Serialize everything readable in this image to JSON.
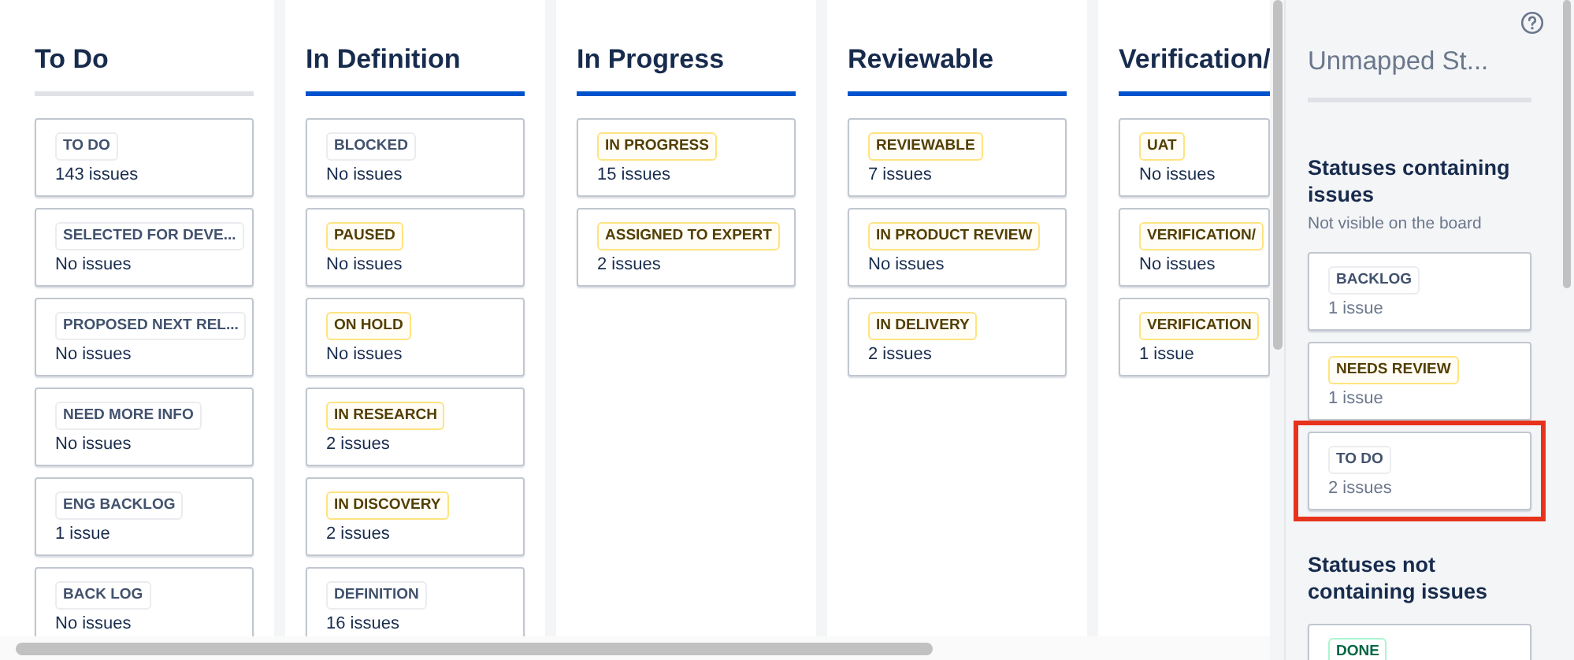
{
  "board": {
    "columns": [
      {
        "name": "To Do",
        "kind": "todo",
        "statuses": [
          {
            "name": "TO DO",
            "kind": "todo",
            "count": "143 issues"
          },
          {
            "name": "SELECTED FOR DEVE...",
            "kind": "todo",
            "count": "No issues"
          },
          {
            "name": "PROPOSED NEXT REL...",
            "kind": "todo",
            "count": "No issues"
          },
          {
            "name": "NEED MORE INFO",
            "kind": "todo",
            "count": "No issues"
          },
          {
            "name": "ENG BACKLOG",
            "kind": "todo",
            "count": "1 issue"
          },
          {
            "name": "BACK LOG",
            "kind": "todo",
            "count": "No issues"
          }
        ]
      },
      {
        "name": "In Definition",
        "kind": "inprogress",
        "statuses": [
          {
            "name": "BLOCKED",
            "kind": "todo",
            "count": "No issues"
          },
          {
            "name": "PAUSED",
            "kind": "inprogress",
            "count": "No issues"
          },
          {
            "name": "ON HOLD",
            "kind": "inprogress",
            "count": "No issues"
          },
          {
            "name": "IN RESEARCH",
            "kind": "inprogress",
            "count": "2 issues"
          },
          {
            "name": "IN DISCOVERY",
            "kind": "inprogress",
            "count": "2 issues"
          },
          {
            "name": "DEFINITION",
            "kind": "todo",
            "count": "16 issues"
          }
        ]
      },
      {
        "name": "In Progress",
        "kind": "inprogress",
        "statuses": [
          {
            "name": "IN PROGRESS",
            "kind": "inprogress",
            "count": "15 issues"
          },
          {
            "name": "ASSIGNED TO EXPERT",
            "kind": "inprogress",
            "count": "2 issues"
          }
        ]
      },
      {
        "name": "Reviewable",
        "kind": "inprogress",
        "statuses": [
          {
            "name": "REVIEWABLE",
            "kind": "inprogress",
            "count": "7 issues"
          },
          {
            "name": "IN PRODUCT REVIEW",
            "kind": "inprogress",
            "count": "No issues"
          },
          {
            "name": "IN DELIVERY",
            "kind": "inprogress",
            "count": "2 issues"
          }
        ]
      },
      {
        "name": "Verification/",
        "kind": "inprogress",
        "statuses": [
          {
            "name": "UAT",
            "kind": "inprogress",
            "count": "No issues"
          },
          {
            "name": "VERIFICATION/",
            "kind": "inprogress",
            "count": "No issues"
          },
          {
            "name": "VERIFICATION",
            "kind": "inprogress",
            "count": "1 issue"
          }
        ]
      }
    ]
  },
  "panel": {
    "title": "Unmapped St...",
    "sections": [
      {
        "heading": "Statuses containing issues",
        "subtitle": "Not visible on the board",
        "statuses": [
          {
            "name": "BACKLOG",
            "kind": "todo",
            "count": "1 issue",
            "highlighted": false
          },
          {
            "name": "NEEDS REVIEW",
            "kind": "inprogress",
            "count": "1 issue",
            "highlighted": false
          },
          {
            "name": "TO DO",
            "kind": "todo",
            "count": "2 issues",
            "highlighted": true
          }
        ]
      },
      {
        "heading": "Statuses not containing issues",
        "statuses": [
          {
            "name": "DONE",
            "kind": "done",
            "highlighted": false
          }
        ]
      }
    ]
  }
}
